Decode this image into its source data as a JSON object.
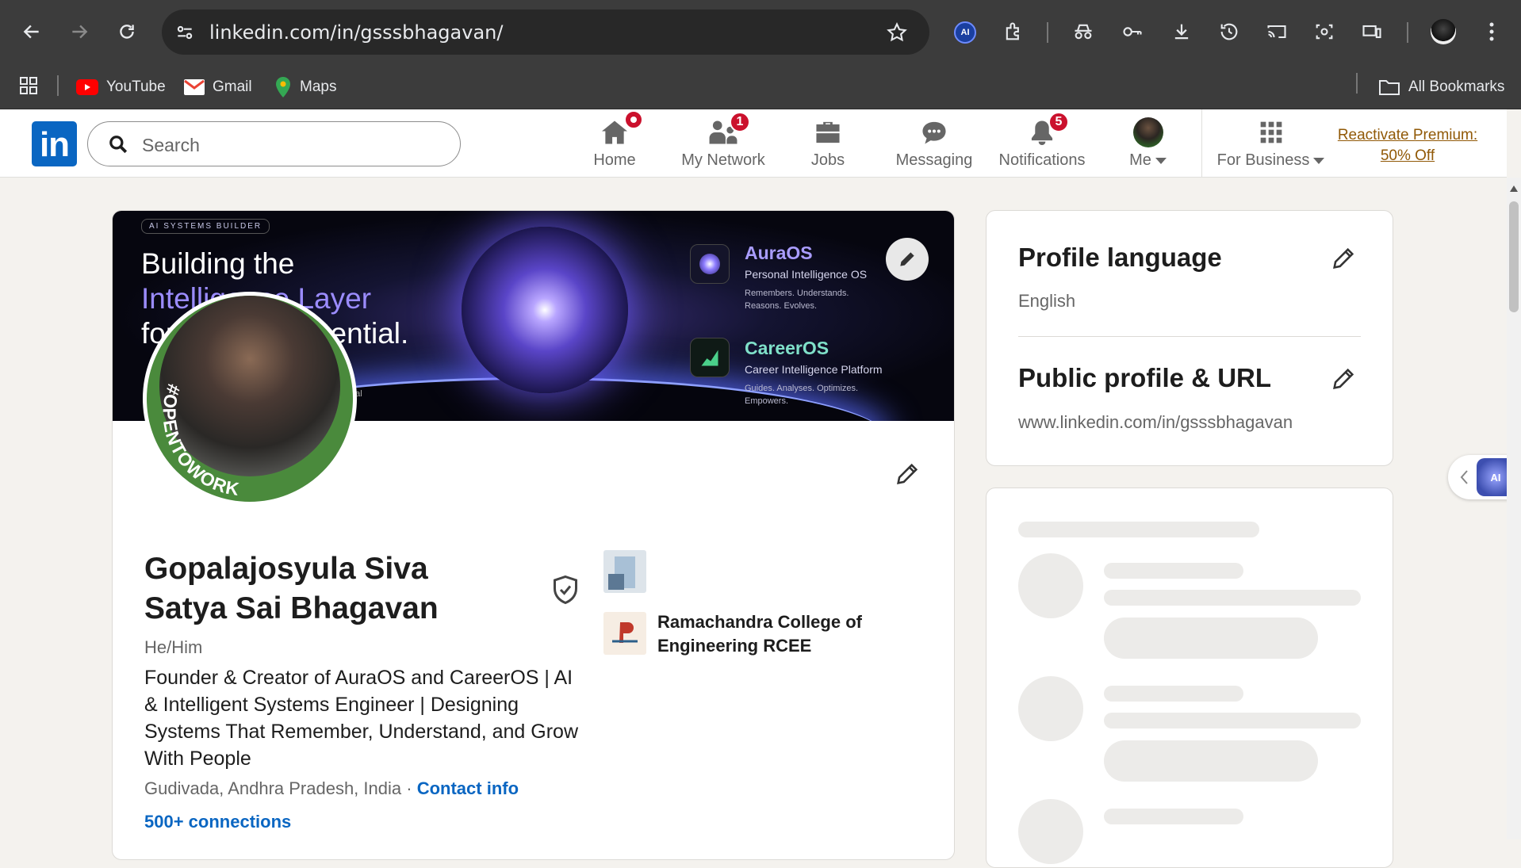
{
  "browser": {
    "url": "linkedin.com/in/gsssbhagavan/",
    "bookmarks": [
      {
        "label": "YouTube",
        "icon": "youtube-icon"
      },
      {
        "label": "Gmail",
        "icon": "gmail-icon"
      },
      {
        "label": "Maps",
        "icon": "maps-icon"
      }
    ],
    "all_bookmarks": "All Bookmarks"
  },
  "linkedin_nav": {
    "logo": "in",
    "search_placeholder": "Search",
    "items": [
      {
        "label": "Home",
        "badge": ""
      },
      {
        "label": "My Network",
        "badge": "1"
      },
      {
        "label": "Jobs",
        "badge": ""
      },
      {
        "label": "Messaging",
        "badge": ""
      },
      {
        "label": "Notifications",
        "badge": "5"
      },
      {
        "label": "Me",
        "badge": ""
      },
      {
        "label": "For Business",
        "badge": ""
      }
    ],
    "premium_line1": "Reactivate Premium:",
    "premium_line2": "50% Off"
  },
  "banner": {
    "tag": "AI SYSTEMS BUILDER",
    "line1": "Building the",
    "line2": "Intelligence Layer",
    "line3": "for Human Potential.",
    "footnote": "nal",
    "products": [
      {
        "name": "AuraOS",
        "subtitle": "Personal Intelligence OS",
        "desc1": "Remembers. Understands.",
        "desc2": "Reasons. Evolves."
      },
      {
        "name": "CareerOS",
        "subtitle": "Career Intelligence Platform",
        "desc1": "Guides. Analyses. Optimizes.",
        "desc2": "Empowers."
      }
    ]
  },
  "profile": {
    "opentowork": "#OPENTOWORK",
    "name": "Gopalajosyula Siva Satya Sai Bhagavan",
    "pronouns": "He/Him",
    "headline": "Founder & Creator of AuraOS and CareerOS | AI & Intelligent Systems Engineer | Designing Systems That Remember, Understand, and Grow With People",
    "location": "Gudivada, Andhra Pradesh, India",
    "contact_info": "Contact info",
    "connections": "500+ connections",
    "education": "Ramachandra College of Engineering RCEE"
  },
  "sidebar": {
    "profile_language_title": "Profile language",
    "profile_language_value": "English",
    "public_profile_title": "Public profile & URL",
    "public_profile_value": "www.linkedin.com/in/gsssbhagavan"
  },
  "colors": {
    "linkedin_blue": "#0a66c2",
    "badge_red": "#cb112d",
    "premium_gold": "#915907",
    "opentowork_green": "#4a8a3c"
  }
}
